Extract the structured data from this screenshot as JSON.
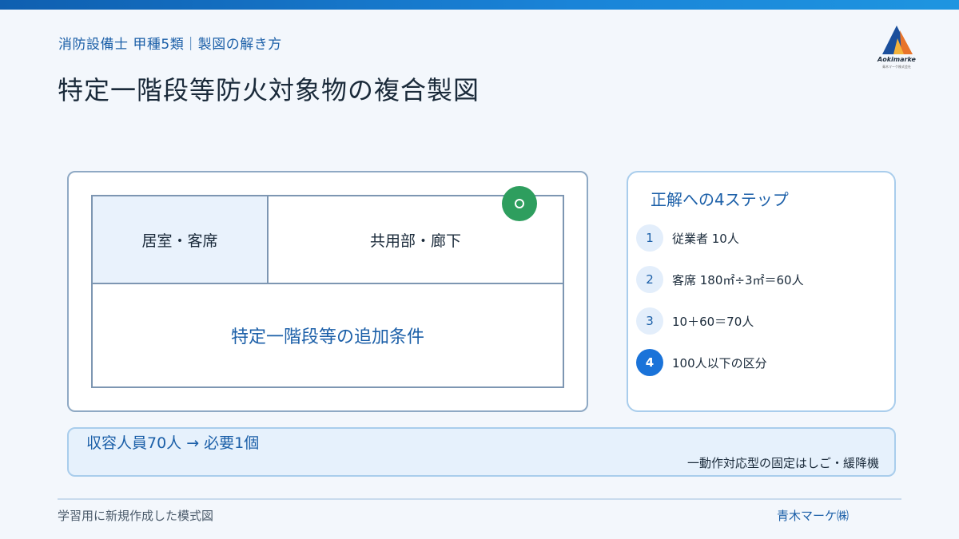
{
  "header": {
    "subtitle": "消防設備士 甲種5類｜製図の解き方",
    "title": "特定一階段等防火対象物の複合製図",
    "logo_text": "Aokimarke",
    "logo_sub": "青木マーケ株式会社"
  },
  "diagram": {
    "room_a": "居室・客席",
    "room_b": "共用部・廊下",
    "room_c": "特定一階段等の追加条件",
    "marker_icon": "installation-marker-icon"
  },
  "steps": {
    "title": "正解への4ステップ",
    "items": [
      {
        "num": "1",
        "text": "従業者 10人"
      },
      {
        "num": "2",
        "text": "客席 180㎡÷3㎡＝60人"
      },
      {
        "num": "3",
        "text": "10＋60＝70人"
      },
      {
        "num": "4",
        "text": "100人以下の区分"
      }
    ],
    "active_step": "4"
  },
  "result": {
    "main": "収容人員70人 → 必要1個",
    "note": "一動作対応型の固定はしご・緩降機"
  },
  "footer": {
    "left": "学習用に新規作成した模式図",
    "right": "青木マーケ㈱"
  },
  "colors": {
    "accent": "#1b5fa8",
    "marker": "#2e9e5e",
    "active_step": "#1a73d9"
  }
}
